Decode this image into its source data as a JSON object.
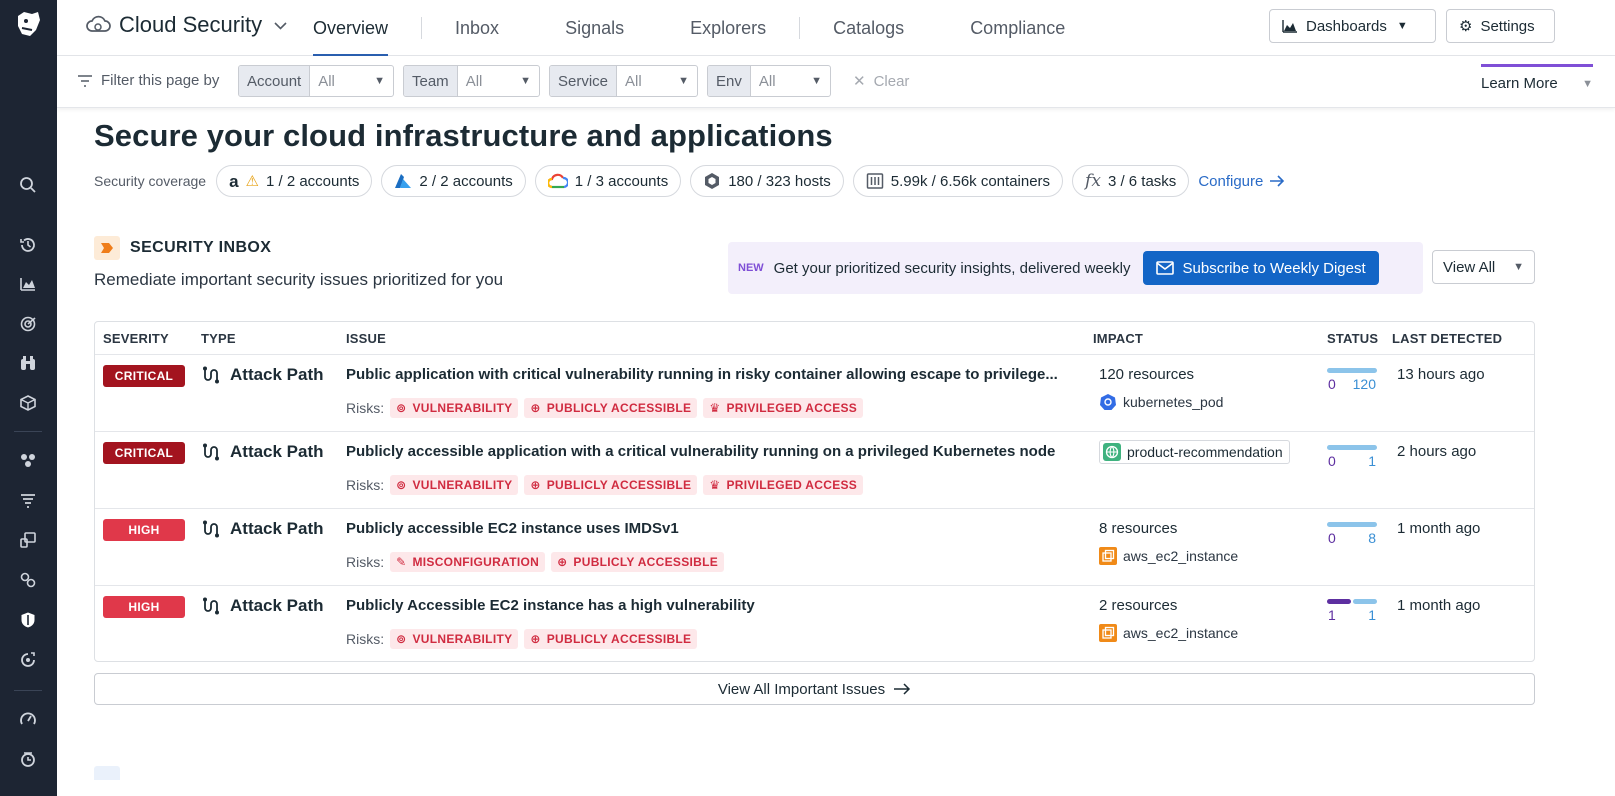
{
  "nav": {
    "product": "Cloud Security",
    "tabs": [
      "Overview",
      "Inbox",
      "Signals",
      "Explorers",
      "Catalogs",
      "Compliance"
    ],
    "dashboards": "Dashboards",
    "settings": "Settings"
  },
  "filters": {
    "label": "Filter this page by",
    "items": [
      {
        "key": "Account",
        "value": "All"
      },
      {
        "key": "Team",
        "value": "All"
      },
      {
        "key": "Service",
        "value": "All"
      },
      {
        "key": "Env",
        "value": "All"
      }
    ],
    "clear": "Clear",
    "learn_more": "Learn More"
  },
  "page": {
    "title": "Secure your cloud infrastructure and applications",
    "coverage_label": "Security coverage",
    "coverage": {
      "aws": "1 / 2 accounts",
      "azure": "2 / 2 accounts",
      "gcp": "1 / 3 accounts",
      "hosts": "180 / 323 hosts",
      "containers": "5.99k / 6.56k containers",
      "tasks": "3 / 6 tasks"
    },
    "configure": "Configure"
  },
  "inbox": {
    "title": "SECURITY INBOX",
    "subtitle": "Remediate important security issues prioritized for you",
    "promo_new": "NEW",
    "promo_text": "Get your prioritized security insights, delivered weekly",
    "subscribe": "Subscribe to Weekly Digest",
    "view_all": "View All",
    "columns": {
      "severity": "SEVERITY",
      "type": "TYPE",
      "issue": "ISSUE",
      "impact": "IMPACT",
      "status": "STATUS",
      "last_detected": "LAST DETECTED"
    },
    "risks_label": "Risks:",
    "rows": [
      {
        "severity": "CRITICAL",
        "type": "Attack Path",
        "issue": "Public application with critical vulnerability running in risky container allowing escape to privilege...",
        "risks": [
          "VULNERABILITY",
          "PUBLICLY ACCESSIBLE",
          "PRIVILEGED ACCESS"
        ],
        "impact_count": "120 resources",
        "impact_resource": "kubernetes_pod",
        "status_left": "0",
        "status_right": "120",
        "detected": "13 hours ago"
      },
      {
        "severity": "CRITICAL",
        "type": "Attack Path",
        "issue": "Publicly accessible application with a critical vulnerability running on a privileged Kubernetes node",
        "risks": [
          "VULNERABILITY",
          "PUBLICLY ACCESSIBLE",
          "PRIVILEGED ACCESS"
        ],
        "impact_resource": "product-recommendation",
        "status_left": "0",
        "status_right": "1",
        "detected": "2 hours ago"
      },
      {
        "severity": "HIGH",
        "type": "Attack Path",
        "issue": "Publicly accessible EC2 instance uses IMDSv1",
        "risks": [
          "MISCONFIGURATION",
          "PUBLICLY ACCESSIBLE"
        ],
        "impact_count": "8 resources",
        "impact_resource": "aws_ec2_instance",
        "status_left": "0",
        "status_right": "8",
        "detected": "1 month ago"
      },
      {
        "severity": "HIGH",
        "type": "Attack Path",
        "issue": "Publicly Accessible EC2 instance has a high vulnerability",
        "risks": [
          "VULNERABILITY",
          "PUBLICLY ACCESSIBLE"
        ],
        "impact_count": "2 resources",
        "impact_resource": "aws_ec2_instance",
        "status_left": "1",
        "status_right": "1",
        "detected": "1 month ago"
      }
    ],
    "view_important": "View All Important Issues"
  },
  "colors": {
    "accent": "#2a5fb0",
    "critical": "#a3141f",
    "high": "#e0384a",
    "purple": "#7f4fd6",
    "status_blue": "#8cc4ea",
    "status_purple": "#5d2fa0"
  }
}
